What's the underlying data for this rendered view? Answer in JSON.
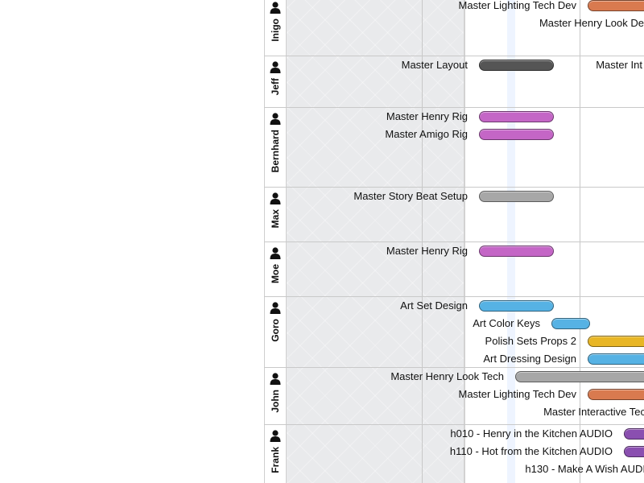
{
  "colors": {
    "orange": "#d97a4f",
    "dark": "#555555",
    "purple": "#c466c6",
    "gray": "#a7a7a7",
    "blue": "#56b2e4",
    "yellow": "#e8b626",
    "violet": "#8a4fb0"
  },
  "lanes": [
    {
      "name": "Inigo"
    },
    {
      "name": "Jeff"
    },
    {
      "name": "Bernhard"
    },
    {
      "name": "Max"
    },
    {
      "name": "Moe"
    },
    {
      "name": "Goro"
    },
    {
      "name": "John"
    },
    {
      "name": "Frank"
    }
  ],
  "tasks": [
    {
      "label": "Master Lighting Tech Dev",
      "color": "orange"
    },
    {
      "label": "Master Henry Look De",
      "color": ""
    },
    {
      "label": "Master Layout",
      "color": "dark"
    },
    {
      "label": "Master Int",
      "color": ""
    },
    {
      "label": "Master Henry Rig",
      "color": "purple"
    },
    {
      "label": "Master Amigo Rig",
      "color": "purple"
    },
    {
      "label": "Master Story Beat Setup",
      "color": "gray"
    },
    {
      "label": "Master Henry Rig",
      "color": "purple"
    },
    {
      "label": "Art Set Design",
      "color": "blue"
    },
    {
      "label": "Art Color Keys",
      "color": "blue"
    },
    {
      "label": "Polish Sets Props 2",
      "color": "yellow"
    },
    {
      "label": "Art Dressing Design",
      "color": "blue"
    },
    {
      "label": "Master Henry Look Tech",
      "color": "gray"
    },
    {
      "label": "Master Lighting Tech Dev",
      "color": "orange"
    },
    {
      "label": "Master Interactive Tec",
      "color": ""
    },
    {
      "label": "h010 - Henry in the Kitchen AUDIO",
      "color": "violet"
    },
    {
      "label": "h110 - Hot from the Kitchen AUDIO",
      "color": "violet"
    },
    {
      "label": "h130 - Make A Wish AUDI",
      "color": ""
    }
  ]
}
